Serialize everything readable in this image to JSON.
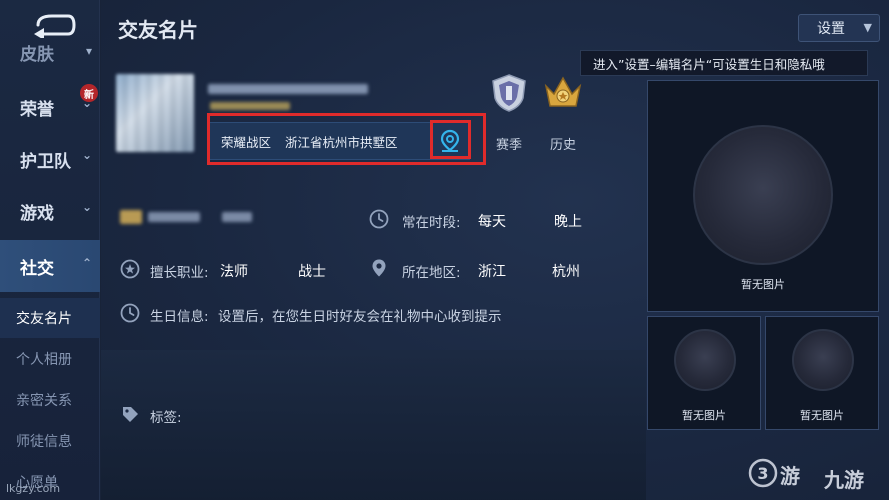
{
  "sidebar": {
    "items": [
      {
        "label": "皮肤"
      },
      {
        "label": "荣誉",
        "badge": "新"
      },
      {
        "label": "护卫队"
      },
      {
        "label": "游戏"
      },
      {
        "label": "社交"
      }
    ],
    "sub_items": [
      {
        "label": "交友名片"
      },
      {
        "label": "个人相册"
      },
      {
        "label": "亲密关系"
      },
      {
        "label": "师徒信息"
      },
      {
        "label": "心愿单"
      }
    ]
  },
  "header": {
    "title": "交友名片",
    "settings_label": "设置",
    "tooltip": "进入”设置–编辑名片“可设置生日和隐私哦"
  },
  "profile": {
    "region": "荣耀战区",
    "location": "浙江省杭州市拱墅区",
    "badges": [
      {
        "label": "赛季",
        "icon": "season-shield-icon"
      },
      {
        "label": "历史",
        "icon": "history-crown-icon"
      }
    ]
  },
  "info": {
    "active_time_label": "常在时段:",
    "active_time_values": [
      "每天",
      "晚上"
    ],
    "role_label": "擅长职业:",
    "role_values": [
      "法师",
      "战士"
    ],
    "area_label": "所在地区:",
    "area_values": [
      "浙江",
      "杭州"
    ],
    "birthday_label": "生日信息:",
    "birthday_text": "设置后，在您生日时好友会在礼物中心收到提示",
    "tags_label": "标签:"
  },
  "photos": {
    "empty_label_big": "暂无图片",
    "empty_label_small_1": "暂无图片",
    "empty_label_small_2": "暂无图片"
  },
  "watermark": {
    "site": "lkgzy.com",
    "logo_left": "游",
    "logo_right": "九游"
  },
  "colors": {
    "highlight_red": "#e02b2b",
    "accent_blue": "#2fa8e0",
    "active_tab": "#2f4f7a"
  }
}
